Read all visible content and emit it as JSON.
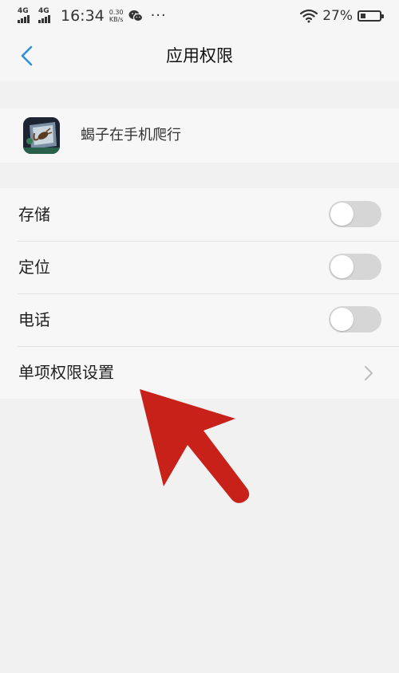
{
  "status_bar": {
    "network_1": "4G",
    "network_2": "4G",
    "time": "16:34",
    "speed_value": "0.30",
    "speed_unit": "KB/s",
    "battery_percent": "27%",
    "battery_level": 0.27,
    "more": "···"
  },
  "header": {
    "title": "应用权限"
  },
  "app": {
    "name": "蝎子在手机爬行"
  },
  "permissions": [
    {
      "label": "存储",
      "enabled": false
    },
    {
      "label": "定位",
      "enabled": false
    },
    {
      "label": "电话",
      "enabled": false
    }
  ],
  "detail_setting": {
    "label": "单项权限设置"
  },
  "colors": {
    "accent": "#2f8fd8",
    "annotation_arrow": "#c7211a",
    "toggle_off": "#d6d6d6"
  }
}
